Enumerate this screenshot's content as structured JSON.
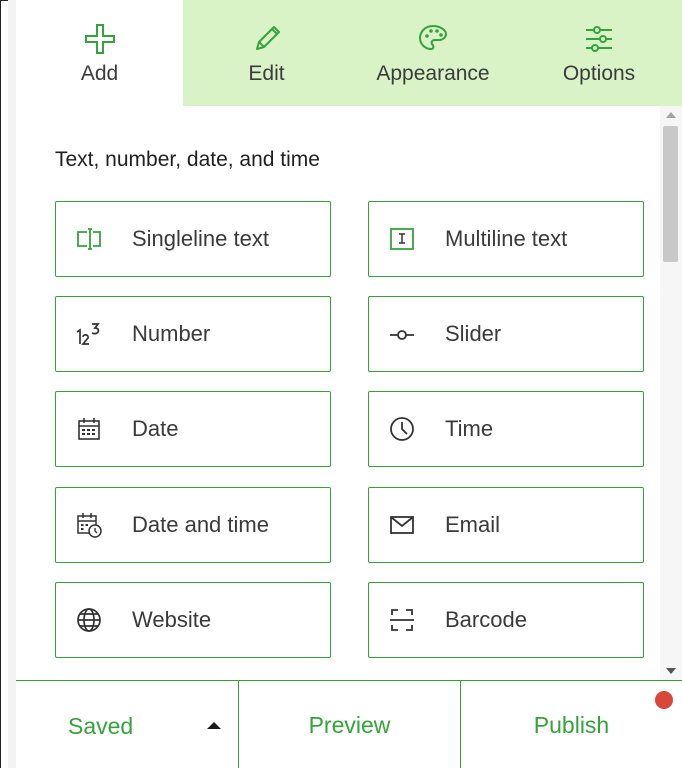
{
  "tabs": [
    {
      "label": "Add",
      "icon": "plus-icon",
      "active": true
    },
    {
      "label": "Edit",
      "icon": "pencil-icon",
      "active": false
    },
    {
      "label": "Appearance",
      "icon": "palette-icon",
      "active": false
    },
    {
      "label": "Options",
      "icon": "sliders-icon",
      "active": false
    }
  ],
  "section": {
    "title": "Text, number, date, and time"
  },
  "fields": [
    {
      "label": "Singleline text",
      "icon": "singleline-text-icon"
    },
    {
      "label": "Multiline text",
      "icon": "multiline-text-icon"
    },
    {
      "label": "Number",
      "icon": "number-icon"
    },
    {
      "label": "Slider",
      "icon": "slider-icon"
    },
    {
      "label": "Date",
      "icon": "calendar-icon"
    },
    {
      "label": "Time",
      "icon": "clock-icon"
    },
    {
      "label": "Date and time",
      "icon": "calendar-clock-icon"
    },
    {
      "label": "Email",
      "icon": "envelope-icon"
    },
    {
      "label": "Website",
      "icon": "globe-icon"
    },
    {
      "label": "Barcode",
      "icon": "barcode-icon"
    }
  ],
  "footer": {
    "saved_label": "Saved",
    "preview_label": "Preview",
    "publish_label": "Publish",
    "publish_has_notification": true
  },
  "colors": {
    "accent": "#35a33b",
    "tab_inactive_bg": "#d9f3c7",
    "notification": "#d9473b"
  }
}
